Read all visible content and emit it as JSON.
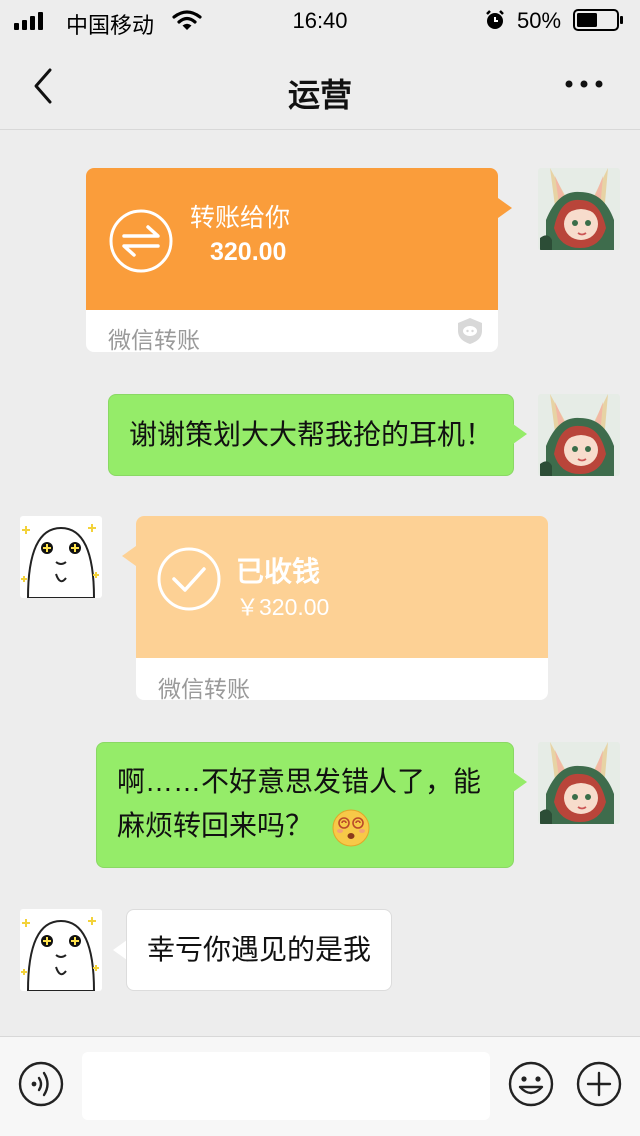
{
  "status_bar": {
    "carrier": "中国移动",
    "time": "16:40",
    "battery": "50%"
  },
  "nav": {
    "title": "运营"
  },
  "messages": [
    {
      "type": "transfer_sent",
      "side": "right",
      "title": "转账给你",
      "amount": "320.00",
      "footer": "微信转账",
      "color": "#fa9d3b"
    },
    {
      "type": "text",
      "side": "right",
      "text": "谢谢策划大大帮我抢的耳机！"
    },
    {
      "type": "transfer_received",
      "side": "left",
      "title": "已收钱",
      "amount": "￥320.00",
      "footer": "微信转账",
      "color": "#fdd195"
    },
    {
      "type": "text",
      "side": "right",
      "line1": "啊……不好意思发错人了，能",
      "line2": "麻烦转回来吗？"
    },
    {
      "type": "text",
      "side": "left",
      "text": "幸亏你遇见的是我"
    }
  ],
  "input_bar": {
    "voice_icon": "voice-icon",
    "emoji_icon": "emoji-icon",
    "plus_icon": "plus-icon",
    "value": ""
  },
  "colors": {
    "background": "#ededed",
    "bubble_green": "#95ec69",
    "transfer_orange": "#fa9d3b",
    "transfer_received": "#fdd195"
  }
}
